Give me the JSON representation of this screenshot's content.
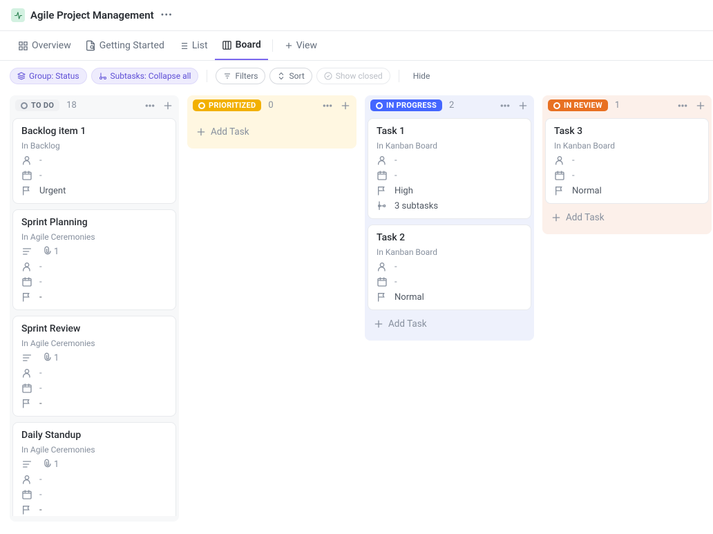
{
  "header": {
    "title": "Agile Project Management"
  },
  "tabs": {
    "overview": "Overview",
    "getting_started": "Getting Started",
    "list": "List",
    "board": "Board",
    "add_view": "View"
  },
  "toolbar": {
    "group": "Group: Status",
    "subtasks": "Subtasks: Collapse all",
    "filters": "Filters",
    "sort": "Sort",
    "show_closed": "Show closed",
    "hide": "Hide"
  },
  "labels": {
    "add_task": "Add Task",
    "empty": "-"
  },
  "columns": [
    {
      "key": "todo",
      "name": "TO DO",
      "count": 18,
      "bgClass": "todo",
      "pillClass": "pill-todo",
      "cards": [
        {
          "title": "Backlog item 1",
          "location": "In Backlog",
          "assignee": "-",
          "date": "-",
          "priority": "Urgent",
          "priorityClass": "flag-urgent"
        },
        {
          "title": "Sprint Planning",
          "location": "In Agile Ceremonies",
          "desc": true,
          "attachments": 1,
          "assignee": "-",
          "date": "-",
          "priority": "-",
          "priorityClass": "flag-none"
        },
        {
          "title": "Sprint Review",
          "location": "In Agile Ceremonies",
          "desc": true,
          "attachments": 1,
          "assignee": "-",
          "date": "-",
          "priority": "-",
          "priorityClass": "flag-none"
        },
        {
          "title": "Daily Standup",
          "location": "In Agile Ceremonies",
          "desc": true,
          "attachments": 1,
          "assignee": "-",
          "date": "-",
          "priority": "-",
          "priorityClass": "flag-none"
        }
      ]
    },
    {
      "key": "prioritized",
      "name": "PRIORITIZED",
      "count": 0,
      "bgClass": "prioritized",
      "pillClass": "pill-prioritized",
      "cards": []
    },
    {
      "key": "inprogress",
      "name": "IN PROGRESS",
      "count": 2,
      "bgClass": "inprogress",
      "pillClass": "pill-inprogress",
      "cards": [
        {
          "title": "Task 1",
          "location": "In Kanban Board",
          "assignee": "-",
          "date": "-",
          "priority": "High",
          "priorityClass": "flag-high",
          "subtasks": "3 subtasks"
        },
        {
          "title": "Task 2",
          "location": "In Kanban Board",
          "assignee": "-",
          "date": "-",
          "priority": "Normal",
          "priorityClass": "flag-normal"
        }
      ]
    },
    {
      "key": "inreview",
      "name": "IN REVIEW",
      "count": 1,
      "bgClass": "inreview",
      "pillClass": "pill-inreview",
      "cards": [
        {
          "title": "Task 3",
          "location": "In Kanban Board",
          "assignee": "-",
          "date": "-",
          "priority": "Normal",
          "priorityClass": "flag-normal"
        }
      ]
    }
  ]
}
